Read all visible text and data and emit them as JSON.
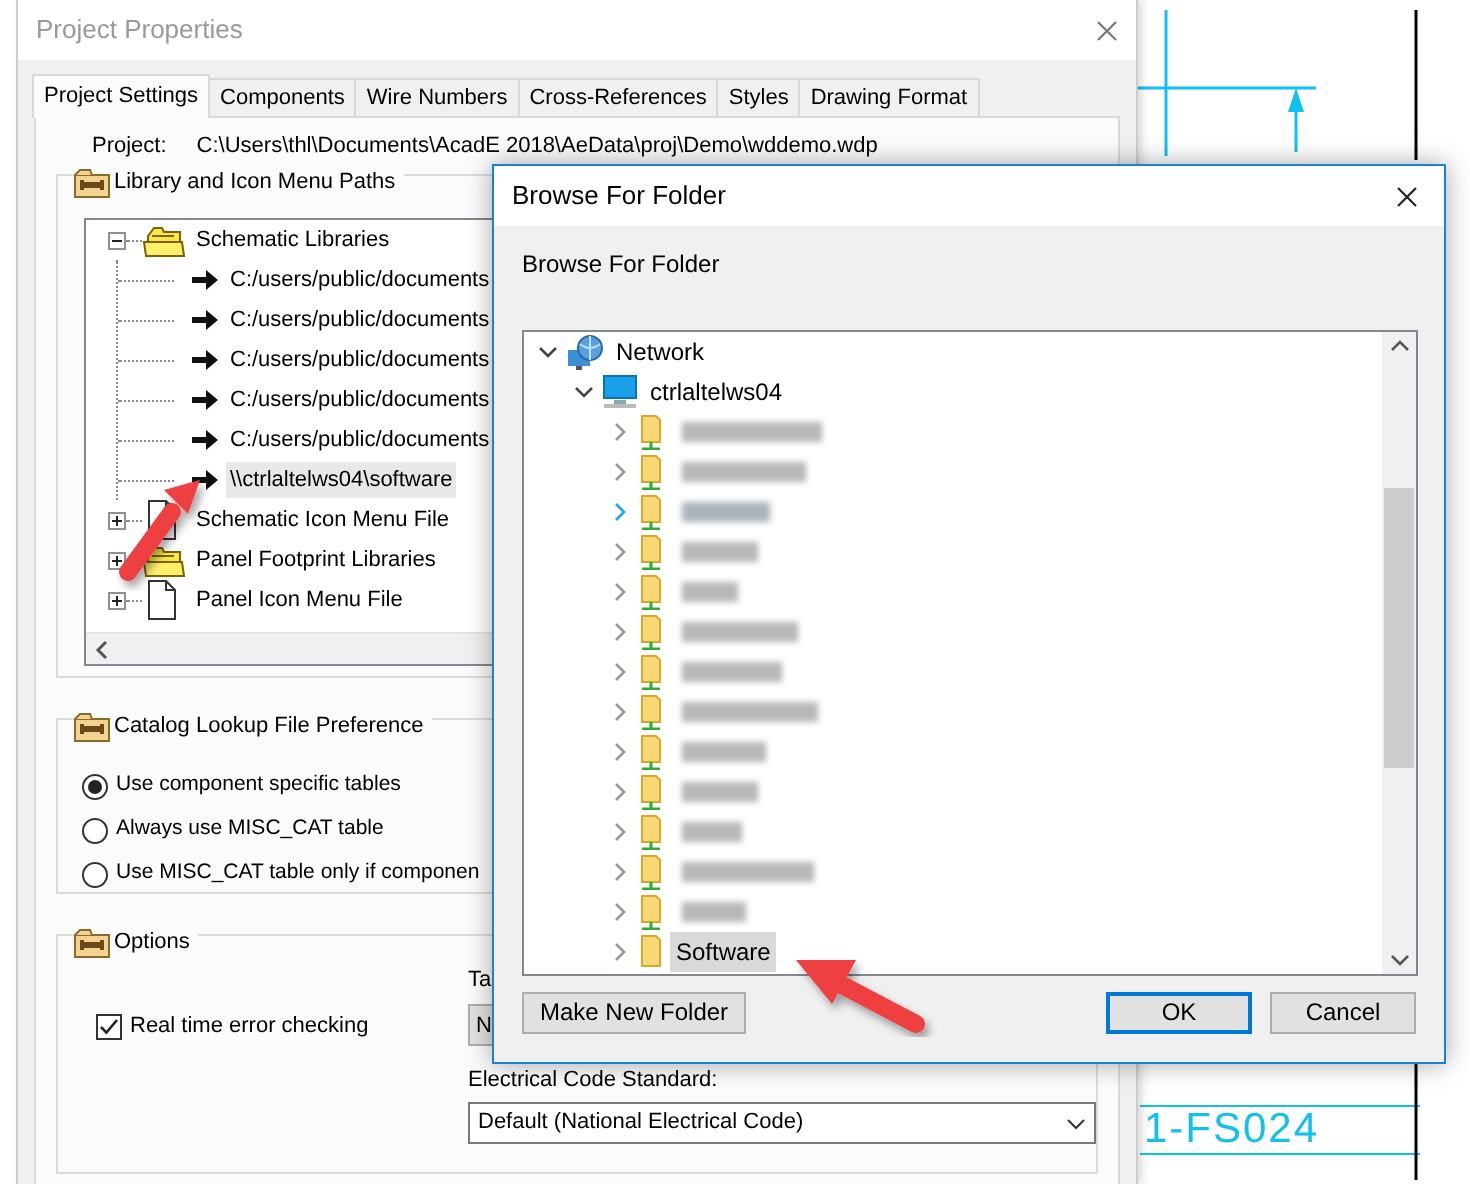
{
  "cad_drawing": {
    "label": "1-FS024"
  },
  "project_properties": {
    "title": "Project Properties",
    "active": false,
    "tabs": [
      {
        "label": "Project Settings",
        "selected": true
      },
      {
        "label": "Components",
        "selected": false
      },
      {
        "label": "Wire Numbers",
        "selected": false
      },
      {
        "label": "Cross-References",
        "selected": false
      },
      {
        "label": "Styles",
        "selected": false
      },
      {
        "label": "Drawing Format",
        "selected": false
      }
    ],
    "project_label": "Project:",
    "project_path": "C:\\Users\\thl\\Documents\\AcadE 2018\\AeData\\proj\\Demo\\wddemo.wdp",
    "library_group": {
      "title": "Library and Icon Menu Paths",
      "tree": [
        {
          "kind": "library",
          "label": "Schematic Libraries",
          "expanded": true,
          "children": [
            {
              "kind": "path",
              "label": "C:/users/public/documents",
              "selected": false
            },
            {
              "kind": "path",
              "label": "C:/users/public/documents",
              "selected": false
            },
            {
              "kind": "path",
              "label": "C:/users/public/documents",
              "selected": false
            },
            {
              "kind": "path",
              "label": "C:/users/public/documents",
              "selected": false
            },
            {
              "kind": "path",
              "label": "C:/users/public/documents",
              "selected": false
            },
            {
              "kind": "path",
              "label": "\\\\ctrlaltelws04\\software",
              "selected": true
            }
          ]
        },
        {
          "kind": "file",
          "label": "Schematic Icon Menu File",
          "expanded": false
        },
        {
          "kind": "library",
          "label": "Panel Footprint Libraries",
          "expanded": false
        },
        {
          "kind": "file",
          "label": "Panel Icon Menu File",
          "expanded": false
        }
      ]
    },
    "catalog_group": {
      "title": "Catalog Lookup File Preference",
      "options": [
        {
          "label": "Use component specific tables",
          "selected": true
        },
        {
          "label": "Always use MISC_CAT table",
          "selected": false
        },
        {
          "label": "Use MISC_CAT table only if componen",
          "selected": false
        }
      ]
    },
    "options_group": {
      "title": "Options",
      "error_checking": {
        "label": "Real time error checking",
        "checked": true
      },
      "partial_label": "Ta",
      "partial_field_value": "N",
      "code_standard": {
        "label": "Electrical Code Standard:",
        "value": "Default (National Electrical Code)"
      }
    }
  },
  "browse_dialog": {
    "title": "Browse For Folder",
    "prompt": "Browse For Folder",
    "tree": [
      {
        "kind": "network",
        "label": "Network",
        "expanded": true,
        "children": [
          {
            "kind": "computer",
            "label": "ctrlaltelws04",
            "expanded": true,
            "children": [
              {
                "kind": "redacted",
                "expanded": false,
                "hovered": false,
                "selected": false
              },
              {
                "kind": "redacted",
                "expanded": false,
                "hovered": false,
                "selected": false
              },
              {
                "kind": "redacted",
                "expanded": false,
                "hovered": true,
                "selected": false
              },
              {
                "kind": "redacted",
                "expanded": false,
                "hovered": false,
                "selected": false
              },
              {
                "kind": "redacted",
                "expanded": false,
                "hovered": false,
                "selected": false
              },
              {
                "kind": "redacted",
                "expanded": false,
                "hovered": false,
                "selected": false
              },
              {
                "kind": "redacted",
                "expanded": false,
                "hovered": false,
                "selected": false
              },
              {
                "kind": "redacted",
                "expanded": false,
                "hovered": false,
                "selected": false
              },
              {
                "kind": "redacted",
                "expanded": false,
                "hovered": false,
                "selected": false
              },
              {
                "kind": "redacted",
                "expanded": false,
                "hovered": false,
                "selected": false
              },
              {
                "kind": "redacted",
                "expanded": false,
                "hovered": false,
                "selected": false
              },
              {
                "kind": "redacted",
                "expanded": false,
                "hovered": false,
                "selected": false
              },
              {
                "kind": "redacted",
                "expanded": false,
                "hovered": false,
                "selected": false
              },
              {
                "kind": "share",
                "label": "Software",
                "expanded": false,
                "hovered": false,
                "selected": true
              }
            ]
          }
        ]
      }
    ],
    "buttons_left": [
      {
        "label": "Make New Folder",
        "default": false
      }
    ],
    "buttons_right": [
      {
        "label": "OK",
        "default": true
      },
      {
        "label": "Cancel",
        "default": false
      }
    ]
  }
}
